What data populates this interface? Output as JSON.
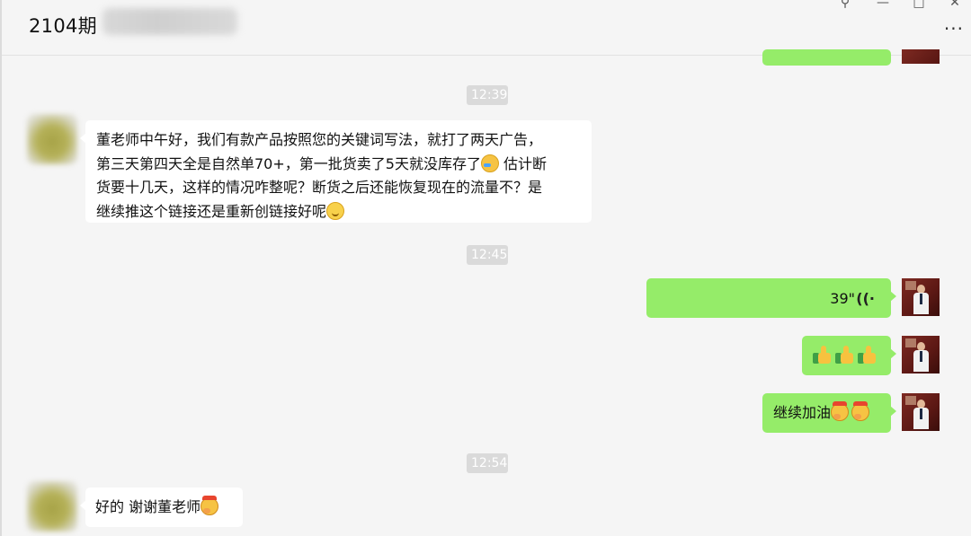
{
  "header": {
    "title": "2104期",
    "pin_icon": "pin-icon",
    "minimize_icon": "minimize-icon",
    "maximize_icon": "maximize-icon",
    "close_icon": "close-icon",
    "more_icon": "more-icon"
  },
  "timestamps": [
    "12:39",
    "12:45",
    "12:54"
  ],
  "messages": [
    {
      "side": "left",
      "lines": [
        "董老师中午好，我们有款产品按照您的关键词写法，就打了两天广告，",
        "第三天第四天全是自然单70+，第一批货卖了5天就没库存了",
        " 估计断",
        "货要十几天，这样的情况咋整呢？断货之后还能恢复现在的流量不？是",
        "继续推这个链接还是重新创链接好呢"
      ],
      "emojis": [
        "face-with-tears-of-joy-emoji",
        "smiling-face-emoji"
      ]
    },
    {
      "side": "right",
      "type": "voice",
      "duration": "39\"",
      "icon": "voice-wave-icon"
    },
    {
      "side": "right",
      "type": "emoji",
      "emojis": [
        "thumbs-up-emoji",
        "thumbs-up-emoji",
        "thumbs-up-emoji"
      ]
    },
    {
      "side": "right",
      "text": "继续加油",
      "emojis": [
        "cheering-face-emoji",
        "cheering-face-emoji"
      ]
    },
    {
      "side": "left",
      "text": "好的 谢谢董老师",
      "emojis": [
        "cheering-face-emoji"
      ]
    }
  ],
  "colors": {
    "background": "#f5f5f5",
    "bubble_self": "#95ec69",
    "bubble_other": "#ffffff",
    "timestamp_bg": "#dadada"
  }
}
